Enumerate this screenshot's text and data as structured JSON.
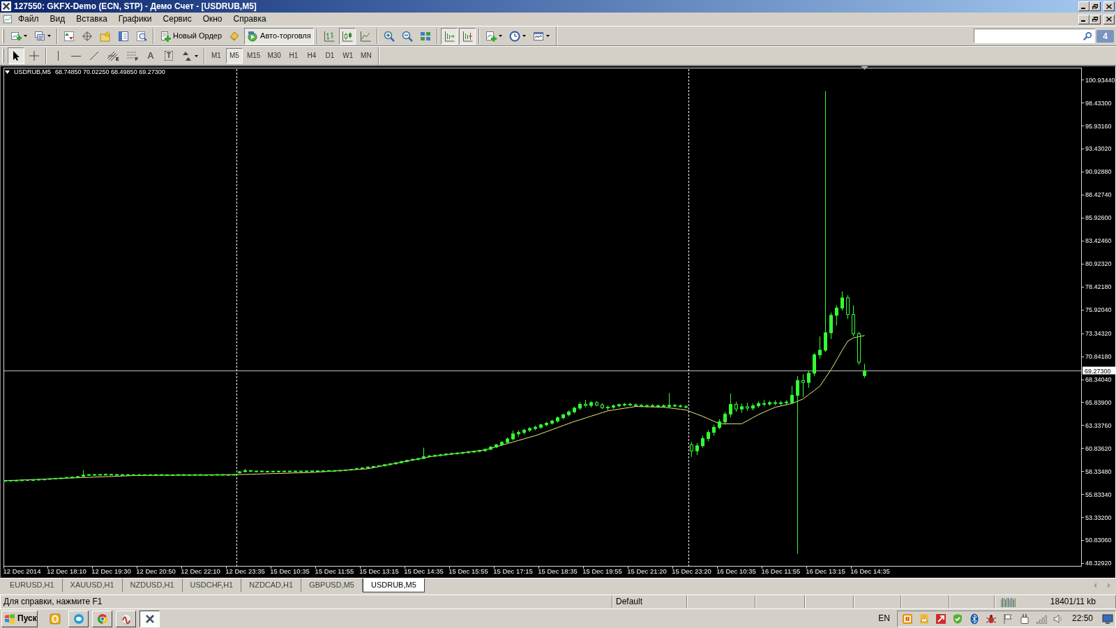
{
  "window": {
    "title": "127550: GKFX-Demo (ECN, STP) - Демо Счет - [USDRUB,M5]"
  },
  "menu": [
    "Файл",
    "Вид",
    "Вставка",
    "Графики",
    "Сервис",
    "Окно",
    "Справка"
  ],
  "toolbar": {
    "groups": [
      [
        {
          "kind": "newchart",
          "pressed": false,
          "menu": true
        },
        {
          "kind": "profiles",
          "pressed": false,
          "menu": true
        }
      ],
      [
        {
          "kind": "market",
          "pressed": false,
          "menu": false
        },
        {
          "kind": "datawindow",
          "pressed": false,
          "menu": false
        },
        {
          "kind": "navigator",
          "pressed": false,
          "menu": false
        },
        {
          "kind": "terminal",
          "pressed": false,
          "menu": false
        },
        {
          "kind": "tester",
          "pressed": false,
          "menu": false
        }
      ],
      [
        {
          "kind": "order",
          "label": "Новый Ордер",
          "pressed": false,
          "menu": false
        },
        {
          "kind": "editor",
          "pressed": false,
          "menu": false
        },
        {
          "kind": "autotrading",
          "label": "Авто-торговля",
          "pressed": true,
          "menu": false
        }
      ],
      [
        {
          "kind": "bars",
          "pressed": false,
          "menu": false
        },
        {
          "kind": "candles",
          "pressed": true,
          "menu": false
        },
        {
          "kind": "line",
          "pressed": false,
          "menu": false
        }
      ],
      [
        {
          "kind": "zoomin",
          "pressed": false,
          "menu": false
        },
        {
          "kind": "zoomout",
          "pressed": false,
          "menu": false
        },
        {
          "kind": "tile",
          "pressed": false,
          "menu": false
        }
      ],
      [
        {
          "kind": "autoscroll",
          "pressed": true,
          "menu": false
        },
        {
          "kind": "shift",
          "pressed": true,
          "menu": false
        }
      ],
      [
        {
          "kind": "indicators",
          "pressed": false,
          "menu": true
        },
        {
          "kind": "periods",
          "pressed": false,
          "menu": true
        },
        {
          "kind": "templates",
          "pressed": false,
          "menu": true
        }
      ]
    ],
    "messages": "4"
  },
  "drawing_tools": [
    {
      "kind": "cursor",
      "selected": true
    },
    {
      "kind": "crosshair",
      "selected": false
    },
    {
      "kind": "vertical",
      "selected": false
    },
    {
      "kind": "horizontal",
      "selected": false
    },
    {
      "kind": "trend",
      "selected": false
    },
    {
      "kind": "channel",
      "glyph": "E",
      "selected": false
    },
    {
      "kind": "fibonacci",
      "glyph": "F",
      "selected": false
    },
    {
      "kind": "text",
      "glyph": "A",
      "selected": false
    },
    {
      "kind": "label",
      "glyph": "T",
      "selected": false
    },
    {
      "kind": "arrows",
      "selected": false
    }
  ],
  "timeframes": [
    {
      "label": "M1",
      "selected": false
    },
    {
      "label": "M5",
      "selected": true
    },
    {
      "label": "M15",
      "selected": false
    },
    {
      "label": "M30",
      "selected": false
    },
    {
      "label": "H1",
      "selected": false
    },
    {
      "label": "H4",
      "selected": false
    },
    {
      "label": "D1",
      "selected": false
    },
    {
      "label": "W1",
      "selected": false
    },
    {
      "label": "MN",
      "selected": false
    }
  ],
  "chart": {
    "symbol": "USDRUB,M5",
    "quote": "68.74850 70.02250 68.49850 69.27300",
    "period_separators": true,
    "chart_data": {
      "type": "candlestick",
      "categories": [
        null,
        null,
        null,
        "12 Dec 2014",
        null,
        null,
        null,
        null,
        null,
        null,
        null,
        "12 Dec 18:10",
        null,
        null,
        null,
        null,
        null,
        null,
        null,
        "12 Dec 19:30",
        null,
        null,
        null,
        null,
        null,
        null,
        null,
        "12 Dec 20:50",
        null,
        null,
        null,
        null,
        null,
        null,
        null,
        "12 Dec 22:10",
        null,
        null,
        null,
        null,
        null,
        null,
        null,
        "12 Dec 23:35",
        null,
        null,
        null,
        null,
        null,
        null,
        null,
        "15 Dec 10:35",
        null,
        null,
        null,
        null,
        null,
        null,
        null,
        "15 Dec 11:55",
        null,
        null,
        null,
        null,
        null,
        null,
        null,
        "15 Dec 13:15",
        null,
        null,
        null,
        null,
        null,
        null,
        null,
        "15 Dec 14:35",
        null,
        null,
        null,
        null,
        null,
        null,
        null,
        "15 Dec 15:55",
        null,
        null,
        null,
        null,
        null,
        null,
        null,
        "15 Dec 17:15",
        null,
        null,
        null,
        null,
        null,
        null,
        null,
        "15 Dec 18:35",
        null,
        null,
        null,
        null,
        null,
        null,
        null,
        "15 Dec 19:55",
        null,
        null,
        null,
        null,
        null,
        null,
        null,
        "15 Dec 21:20",
        null,
        null,
        null,
        null,
        null,
        null,
        null,
        "15 Dec 23:20",
        null,
        null,
        null,
        null,
        null,
        null,
        null,
        "16 Dec 10:35",
        null,
        null,
        null,
        null,
        null,
        null,
        null,
        "16 Dec 11:55",
        null,
        null,
        null,
        null,
        null,
        null,
        null,
        "16 Dec 13:15",
        null,
        null,
        null,
        null,
        null,
        null,
        null,
        "16 Dec 14:35"
      ],
      "ylim": [
        48.03,
        102.25
      ],
      "yticks": [
        {
          "value": 48.3292,
          "label": "48.32920"
        },
        {
          "value": 50.8306,
          "label": "50.83060"
        },
        {
          "value": 53.332,
          "label": "53.33200"
        },
        {
          "value": 55.8334,
          "label": "55.83340"
        },
        {
          "value": 58.3348,
          "label": "58.33480"
        },
        {
          "value": 60.8362,
          "label": "60.83620"
        },
        {
          "value": 63.3376,
          "label": "63.33760"
        },
        {
          "value": 65.839,
          "label": "65.83900"
        },
        {
          "value": 68.3404,
          "label": "68.34040"
        },
        {
          "value": 70.8418,
          "label": "70.84180"
        },
        {
          "value": 73.3432,
          "label": "73.34320"
        },
        {
          "value": 75.9204,
          "label": "75.92040"
        },
        {
          "value": 78.4218,
          "label": "78.42180"
        },
        {
          "value": 80.9232,
          "label": "80.92320"
        },
        {
          "value": 83.4246,
          "label": "83.42460"
        },
        {
          "value": 85.926,
          "label": "85.92600"
        },
        {
          "value": 88.4274,
          "label": "88.42740"
        },
        {
          "value": 90.9288,
          "label": "90.92880"
        },
        {
          "value": 93.4302,
          "label": "93.43020"
        },
        {
          "value": 95.9316,
          "label": "95.93160"
        },
        {
          "value": 98.433,
          "label": "98.43300"
        },
        {
          "value": 100.9344,
          "label": "100.93440"
        }
      ],
      "series": [
        {
          "type": "candlestick",
          "color": "#33ff33",
          "ohlc": [
            [
              57.3,
              57.36,
              57.26,
              57.32
            ],
            [
              57.32,
              57.38,
              57.28,
              57.34
            ],
            [
              57.34,
              57.4,
              57.3,
              57.33
            ],
            [
              57.33,
              57.42,
              57.3,
              57.38
            ],
            [
              57.38,
              57.44,
              57.34,
              57.4
            ],
            [
              57.4,
              57.46,
              57.35,
              57.39
            ],
            [
              57.39,
              57.48,
              57.36,
              57.45
            ],
            [
              57.45,
              57.52,
              57.4,
              57.47
            ],
            [
              57.47,
              57.55,
              57.43,
              57.52
            ],
            [
              57.52,
              57.6,
              57.48,
              57.57
            ],
            [
              57.57,
              57.63,
              57.52,
              57.6
            ],
            [
              57.6,
              57.68,
              57.55,
              57.66
            ],
            [
              57.66,
              57.74,
              57.61,
              57.7
            ],
            [
              57.7,
              57.8,
              57.66,
              57.76
            ],
            [
              57.76,
              58.45,
              57.72,
              57.9
            ],
            [
              57.9,
              58.02,
              57.84,
              57.96
            ],
            [
              57.96,
              58.04,
              57.9,
              57.94
            ],
            [
              57.94,
              58.02,
              57.88,
              57.98
            ],
            [
              57.98,
              58.06,
              57.92,
              57.99
            ],
            [
              57.99,
              58.05,
              57.93,
              57.97
            ],
            [
              57.97,
              58.03,
              57.91,
              57.95
            ],
            [
              57.95,
              58.02,
              57.9,
              57.96
            ],
            [
              57.96,
              58.01,
              57.91,
              57.94
            ],
            [
              57.94,
              58.0,
              57.89,
              57.95
            ],
            [
              57.95,
              58.01,
              57.9,
              57.93
            ],
            [
              57.93,
              57.99,
              57.88,
              57.95
            ],
            [
              57.95,
              58.0,
              57.9,
              57.94
            ],
            [
              57.94,
              57.99,
              57.89,
              57.96
            ],
            [
              57.96,
              58.01,
              57.91,
              57.95
            ],
            [
              57.95,
              58.0,
              57.9,
              57.93
            ],
            [
              57.93,
              57.98,
              57.88,
              57.95
            ],
            [
              57.95,
              58.0,
              57.9,
              57.96
            ],
            [
              57.96,
              58.02,
              57.91,
              57.94
            ],
            [
              57.94,
              57.99,
              57.89,
              57.95
            ],
            [
              57.95,
              58.0,
              57.9,
              57.96
            ],
            [
              57.96,
              58.01,
              57.91,
              57.95
            ],
            [
              57.95,
              58.0,
              57.9,
              57.94
            ],
            [
              57.94,
              57.99,
              57.89,
              57.96
            ],
            [
              57.96,
              58.02,
              57.91,
              57.97
            ],
            [
              57.97,
              58.03,
              57.92,
              57.95
            ],
            [
              57.95,
              58.01,
              57.9,
              57.96
            ],
            [
              57.96,
              58.02,
              57.91,
              57.98
            ],
            [
              58.15,
              58.35,
              58.1,
              58.28
            ],
            [
              58.28,
              58.6,
              58.22,
              58.4
            ],
            [
              58.4,
              58.48,
              58.25,
              58.32
            ],
            [
              58.32,
              58.4,
              58.26,
              58.35
            ],
            [
              58.35,
              58.42,
              58.28,
              58.3
            ],
            [
              58.3,
              58.38,
              58.24,
              58.33
            ],
            [
              58.33,
              58.4,
              58.27,
              58.31
            ],
            [
              58.31,
              58.37,
              58.25,
              58.34
            ],
            [
              58.34,
              58.41,
              58.28,
              58.32
            ],
            [
              58.32,
              58.38,
              58.26,
              58.35
            ],
            [
              58.35,
              58.42,
              58.29,
              58.33
            ],
            [
              58.33,
              58.39,
              58.27,
              58.36
            ],
            [
              58.36,
              58.43,
              58.3,
              58.34
            ],
            [
              58.34,
              58.4,
              58.28,
              58.37
            ],
            [
              58.37,
              58.45,
              58.31,
              58.35
            ],
            [
              58.35,
              58.42,
              58.29,
              58.38
            ],
            [
              58.38,
              58.46,
              58.32,
              58.4
            ],
            [
              58.4,
              58.48,
              58.34,
              58.39
            ],
            [
              58.39,
              58.47,
              58.33,
              58.43
            ],
            [
              58.43,
              58.52,
              58.37,
              58.47
            ],
            [
              58.47,
              58.58,
              58.41,
              58.55
            ],
            [
              58.55,
              58.68,
              58.48,
              58.64
            ],
            [
              58.64,
              58.76,
              58.56,
              58.7
            ],
            [
              58.7,
              58.84,
              58.63,
              58.79
            ],
            [
              58.79,
              58.92,
              58.71,
              58.86
            ],
            [
              58.86,
              58.98,
              58.78,
              58.93
            ],
            [
              58.93,
              59.1,
              58.85,
              59.05
            ],
            [
              59.05,
              59.2,
              58.97,
              59.14
            ],
            [
              59.14,
              59.32,
              59.06,
              59.26
            ],
            [
              59.26,
              59.45,
              59.18,
              59.4
            ],
            [
              59.4,
              59.58,
              59.3,
              59.52
            ],
            [
              59.52,
              59.7,
              59.44,
              59.63
            ],
            [
              59.63,
              59.8,
              59.52,
              59.72
            ],
            [
              59.72,
              60.9,
              59.64,
              59.92
            ],
            [
              59.92,
              60.1,
              59.8,
              59.98
            ],
            [
              59.98,
              60.15,
              59.88,
              60.05
            ],
            [
              60.05,
              60.22,
              59.94,
              60.12
            ],
            [
              60.12,
              60.3,
              60.02,
              60.2
            ],
            [
              60.2,
              60.36,
              60.1,
              60.26
            ],
            [
              60.26,
              60.42,
              60.15,
              60.31
            ],
            [
              60.31,
              60.48,
              60.2,
              60.36
            ],
            [
              60.36,
              60.55,
              60.26,
              60.44
            ],
            [
              60.44,
              60.6,
              60.33,
              60.5
            ],
            [
              60.5,
              60.68,
              60.4,
              60.57
            ],
            [
              60.57,
              60.8,
              60.46,
              60.72
            ],
            [
              60.72,
              61.05,
              60.62,
              60.96
            ],
            [
              60.96,
              61.3,
              60.85,
              61.22
            ],
            [
              61.22,
              61.6,
              61.1,
              61.48
            ],
            [
              61.48,
              62.0,
              61.36,
              61.85
            ],
            [
              61.85,
              62.75,
              61.7,
              62.4
            ],
            [
              62.4,
              62.8,
              62.1,
              62.55
            ],
            [
              62.55,
              62.95,
              62.35,
              62.8
            ],
            [
              62.8,
              63.15,
              62.6,
              62.98
            ],
            [
              62.98,
              63.3,
              62.8,
              63.12
            ],
            [
              63.12,
              63.5,
              62.95,
              63.38
            ],
            [
              63.38,
              63.7,
              63.2,
              63.55
            ],
            [
              63.55,
              63.95,
              63.4,
              63.8
            ],
            [
              63.8,
              64.3,
              63.62,
              64.15
            ],
            [
              64.15,
              64.6,
              63.98,
              64.48
            ],
            [
              64.48,
              64.95,
              64.3,
              64.8
            ],
            [
              64.8,
              65.35,
              64.62,
              65.2
            ],
            [
              65.2,
              65.85,
              65.0,
              65.62
            ],
            [
              65.62,
              66.1,
              65.3,
              65.5
            ],
            [
              65.5,
              65.95,
              65.25,
              65.8
            ],
            [
              65.8,
              65.98,
              65.4,
              65.55
            ],
            [
              65.55,
              65.75,
              65.1,
              65.25
            ],
            [
              65.25,
              65.5,
              64.95,
              65.3
            ],
            [
              65.3,
              65.6,
              65.12,
              65.45
            ],
            [
              65.45,
              65.7,
              65.28,
              65.58
            ],
            [
              65.58,
              65.78,
              65.4,
              65.62
            ],
            [
              65.62,
              65.8,
              65.44,
              65.55
            ],
            [
              65.55,
              65.72,
              65.38,
              65.5
            ],
            [
              65.5,
              65.66,
              65.32,
              65.42
            ],
            [
              65.42,
              65.6,
              65.25,
              65.48
            ],
            [
              65.48,
              65.64,
              65.3,
              65.4
            ],
            [
              65.4,
              65.58,
              65.22,
              65.46
            ],
            [
              65.46,
              65.62,
              65.28,
              65.38
            ],
            [
              65.38,
              66.85,
              65.2,
              65.5
            ],
            [
              65.5,
              65.66,
              65.3,
              65.44
            ],
            [
              65.44,
              65.6,
              65.26,
              65.36
            ],
            [
              65.36,
              65.55,
              65.18,
              65.3
            ],
            [
              61.2,
              61.5,
              59.9,
              60.55
            ],
            [
              60.55,
              61.4,
              60.1,
              61.1
            ],
            [
              61.1,
              62.2,
              60.9,
              61.9
            ],
            [
              61.9,
              62.8,
              61.6,
              62.55
            ],
            [
              62.55,
              63.4,
              62.2,
              63.1
            ],
            [
              63.1,
              64.0,
              62.9,
              63.7
            ],
            [
              63.7,
              64.8,
              63.4,
              64.55
            ],
            [
              64.55,
              66.8,
              64.2,
              65.6
            ],
            [
              65.6,
              65.9,
              64.8,
              65.1
            ],
            [
              65.1,
              65.7,
              64.7,
              65.35
            ],
            [
              65.35,
              65.8,
              64.9,
              65.2
            ],
            [
              65.2,
              65.7,
              64.95,
              65.45
            ],
            [
              65.45,
              65.95,
              65.25,
              65.7
            ],
            [
              65.7,
              66.1,
              65.4,
              65.65
            ],
            [
              65.65,
              66.0,
              65.45,
              65.8
            ],
            [
              65.8,
              66.05,
              65.5,
              65.72
            ],
            [
              65.72,
              66.0,
              65.48,
              65.78
            ],
            [
              65.78,
              66.05,
              65.55,
              65.85
            ],
            [
              65.8,
              67.6,
              65.7,
              66.6
            ],
            [
              66.6,
              68.7,
              49.34,
              68.2
            ],
            [
              68.2,
              68.9,
              66.4,
              68.0
            ],
            [
              68.0,
              69.3,
              67.4,
              69.0
            ],
            [
              69.0,
              71.2,
              68.7,
              71.0
            ],
            [
              71.0,
              73.0,
              70.6,
              71.5
            ],
            [
              71.5,
              99.7,
              71.3,
              73.4
            ],
            [
              73.4,
              75.6,
              72.7,
              75.3
            ],
            [
              75.3,
              76.4,
              74.2,
              76.1
            ],
            [
              76.1,
              77.9,
              75.8,
              77.2
            ],
            [
              77.2,
              77.5,
              74.9,
              75.4
            ],
            [
              75.4,
              76.4,
              73.0,
              73.3
            ],
            [
              73.3,
              73.5,
              69.9,
              70.2
            ],
            [
              68.7485,
              70.0225,
              68.4985,
              69.273
            ],
            null
          ]
        },
        {
          "type": "line",
          "color": "#eeee88",
          "values": [
            57.3,
            57.33,
            57.35,
            57.38,
            57.4,
            57.43,
            57.45,
            57.48,
            57.5,
            57.53,
            57.55,
            57.58,
            57.6,
            57.62,
            57.65,
            57.67,
            57.69,
            57.72,
            57.74,
            57.76,
            57.79,
            57.81,
            57.83,
            57.86,
            57.88,
            57.88,
            57.89,
            57.89,
            57.9,
            57.9,
            57.9,
            57.91,
            57.91,
            57.92,
            57.92,
            57.92,
            57.93,
            57.93,
            57.94,
            57.94,
            57.95,
            57.95,
            57.97,
            57.99,
            58.0,
            58.02,
            58.04,
            58.06,
            58.08,
            58.09,
            58.11,
            58.13,
            58.15,
            58.16,
            58.18,
            58.2,
            58.24,
            58.28,
            58.32,
            58.36,
            58.4,
            58.44,
            58.48,
            58.52,
            58.56,
            58.6,
            58.72,
            58.84,
            58.95,
            59.07,
            59.19,
            59.31,
            59.43,
            59.55,
            59.66,
            59.78,
            59.9,
            59.98,
            60.05,
            60.13,
            60.2,
            60.28,
            60.35,
            60.43,
            60.5,
            60.58,
            60.65,
            60.82,
            61.0,
            61.17,
            61.34,
            61.51,
            61.68,
            61.86,
            62.03,
            62.2,
            62.42,
            62.64,
            62.86,
            63.09,
            63.31,
            63.53,
            63.75,
            63.94,
            64.13,
            64.33,
            64.52,
            64.71,
            64.9,
            65.0,
            65.09,
            65.19,
            65.28,
            65.38,
            65.36,
            65.35,
            65.33,
            65.32,
            65.3,
            65.23,
            65.15,
            65.08,
            65.0,
            64.77,
            64.53,
            64.3,
            64.03,
            63.77,
            63.5,
            63.5,
            63.5,
            63.5,
            63.5,
            63.83,
            64.17,
            64.5,
            64.77,
            65.03,
            65.3,
            65.43,
            65.57,
            65.7,
            65.95,
            66.2,
            66.67,
            67.13,
            67.6,
            68.5,
            69.4,
            70.45,
            71.5,
            72.5,
            72.85,
            72.98,
            73.1,
            null
          ]
        }
      ],
      "ref_lines": [
        {
          "axis": "y",
          "value": 69.273,
          "label": "69.27300",
          "color": "#c0c0c0",
          "line_style": "solid"
        }
      ]
    }
  },
  "tabs": [
    {
      "label": "EURUSD,H1",
      "selected": false
    },
    {
      "label": "XAUUSD,H1",
      "selected": false
    },
    {
      "label": "NZDUSD,H1",
      "selected": false
    },
    {
      "label": "USDCHF,H1",
      "selected": false
    },
    {
      "label": "NZDCAD,H1",
      "selected": false
    },
    {
      "label": "GBPUSD,M5",
      "selected": false
    },
    {
      "label": "USDRUB,M5",
      "selected": true
    }
  ],
  "status_bar": {
    "help": "Для справки, нажмите F1",
    "profile": "Default",
    "traffic": "18401/11 kb"
  },
  "taskbar": {
    "start": "Пуск",
    "tasks": [
      {
        "kind": "chat",
        "active": false
      },
      {
        "kind": "wheel",
        "active": false
      },
      {
        "kind": "swirl",
        "active": false
      },
      {
        "kind": "cross",
        "active": true
      }
    ],
    "language": "EN",
    "clock": "22:50"
  }
}
